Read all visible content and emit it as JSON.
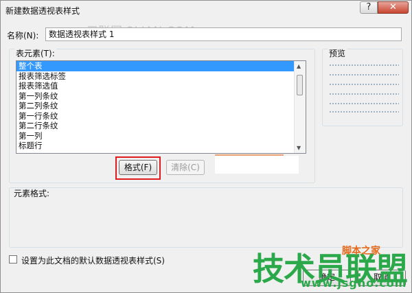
{
  "window": {
    "title": "新建数据透视表样式",
    "help_label": "?",
    "close_label": "✕"
  },
  "watermark": {
    "top": "三联网 3LIAN.COM",
    "logo": "技术员联盟",
    "small": "脚本之家",
    "url": "www.jsgho.com"
  },
  "name_field": {
    "label": "名称(N):",
    "value": "数据透视表样式 1"
  },
  "elements": {
    "label": "表元素(T):",
    "items": [
      "整个表",
      "报表筛选标签",
      "报表筛选值",
      "第一列条纹",
      "第二列条纹",
      "第一行条纹",
      "第二行条纹",
      "第一列",
      "标题行"
    ],
    "selected_index": 0
  },
  "preview": {
    "label": "预览"
  },
  "buttons": {
    "format": "格式(F)",
    "clear": "清除(C)",
    "ok": "确定",
    "cancel": "取消"
  },
  "element_format": {
    "label": "元素格式:"
  },
  "default_checkbox": {
    "label": "设置为此文档的默认数据透视表样式(S)",
    "checked": false
  },
  "colors": {
    "selection": "#3399ff",
    "highlight": "#e01b1b",
    "watermark_green": "#2aa84a"
  }
}
